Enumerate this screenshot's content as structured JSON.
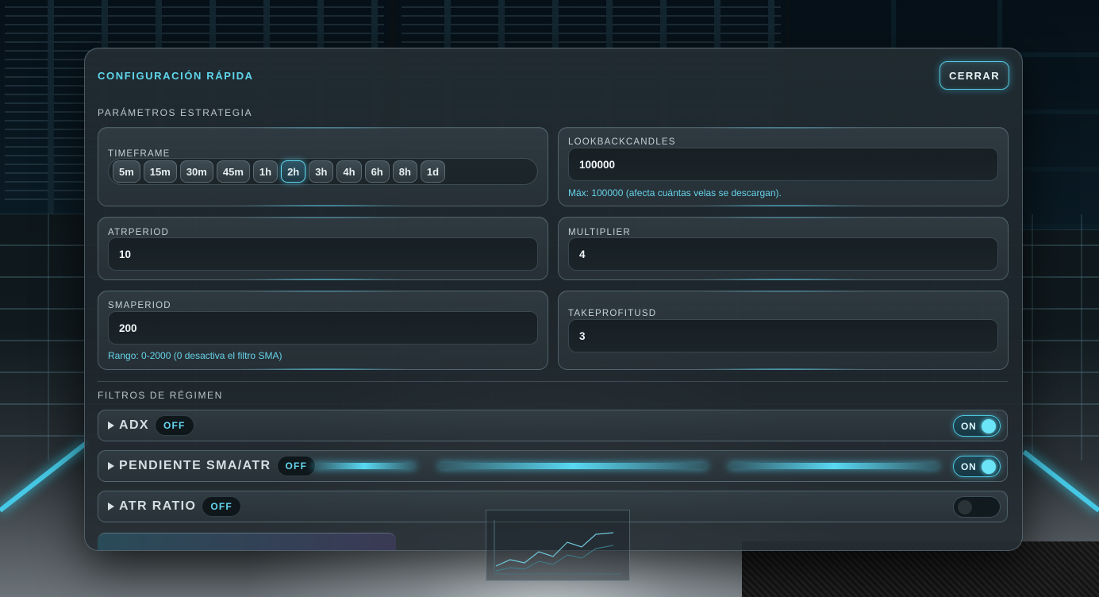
{
  "panel": {
    "title": "CONFIGURACIÓN RÁPIDA",
    "close_label": "CERRAR"
  },
  "strategy": {
    "section_label": "PARÁMETROS ESTRATEGIA",
    "timeframe": {
      "label": "TIMEFRAME",
      "options": [
        "5m",
        "15m",
        "30m",
        "45m",
        "1h",
        "2h",
        "3h",
        "4h",
        "6h",
        "8h",
        "1d"
      ],
      "selected": "2h"
    },
    "lookback": {
      "label": "LOOKBACKCANDLES",
      "value": "100000",
      "hint": "Máx: 100000 (afecta cuántas velas se descargan)."
    },
    "atrperiod": {
      "label": "ATRPERIOD",
      "value": "10"
    },
    "multiplier": {
      "label": "MULTIPLIER",
      "value": "4"
    },
    "smaperiod": {
      "label": "SMAPERIOD",
      "value": "200",
      "hint": "Rango: 0-2000 (0 desactiva el filtro SMA)"
    },
    "takeprofit": {
      "label": "TAKEPROFITUSD",
      "value": "3"
    }
  },
  "filters": {
    "section_label": "FILTROS DE RÉGIMEN",
    "items": [
      {
        "name": "ADX",
        "badge": "OFF",
        "toggle_label": "ON",
        "enabled": true
      },
      {
        "name": "PENDIENTE SMA/ATR",
        "badge": "OFF",
        "toggle_label": "ON",
        "enabled": true
      },
      {
        "name": "ATR RATIO",
        "badge": "OFF",
        "toggle_label": "",
        "enabled": false
      }
    ]
  },
  "colors": {
    "accent": "#5fd6ec",
    "panel_bg": "#222c32",
    "field_bg": "#171f24"
  }
}
